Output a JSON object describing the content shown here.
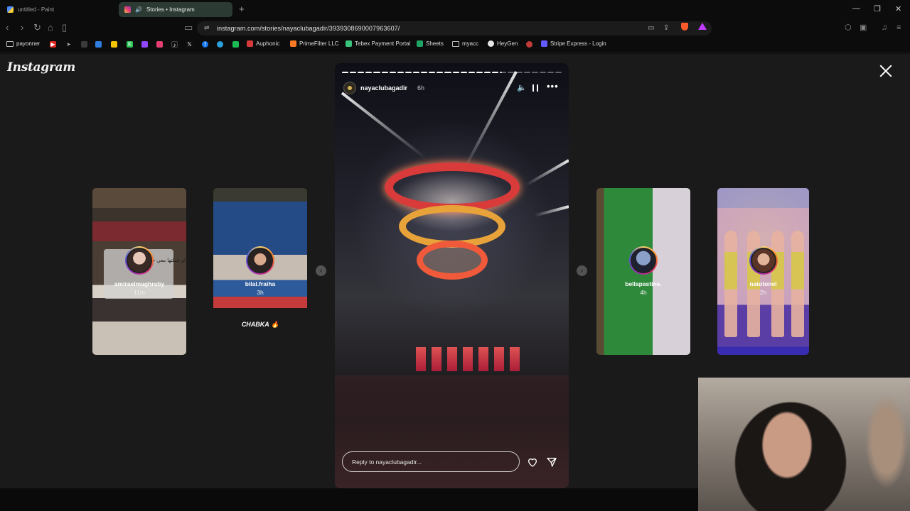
{
  "browser": {
    "tabs": [
      {
        "title": "untitled - Paint",
        "active": false
      },
      {
        "title": "Stories • Instagram",
        "active": true
      }
    ],
    "url": "instagram.com/stories/nayaclubagadir/3939308690007963607/",
    "bookmarks": [
      {
        "label": "payonner"
      },
      {
        "label": "Auphonic"
      },
      {
        "label": "PrimeFilter LLC"
      },
      {
        "label": "Tebex Payment Portal"
      },
      {
        "label": "Sheets"
      },
      {
        "label": "myacc"
      },
      {
        "label": "HeyGen"
      },
      {
        "label": "Stripe Express - Login"
      }
    ]
  },
  "instagram": {
    "logo": "Instagram",
    "story": {
      "username": "nayaclubagadir",
      "time": "6h",
      "reply_placeholder": "Reply to nayaclubagadir..."
    },
    "cards": [
      {
        "username": "amiraelmaghraby",
        "time": "11m",
        "caption": "لو عملتها معي حابين يكون"
      },
      {
        "username": "bilal.fraiha",
        "time": "3h",
        "caption": "CHABKA 🔥"
      },
      {
        "username": "bellapastine.",
        "time": "4h"
      },
      {
        "username": "natotonel",
        "time": "2h"
      }
    ]
  },
  "colors": {
    "story_ring": "#d62976",
    "active_tab": "#2b3b33",
    "brave_shield": "#ff5a2c"
  }
}
